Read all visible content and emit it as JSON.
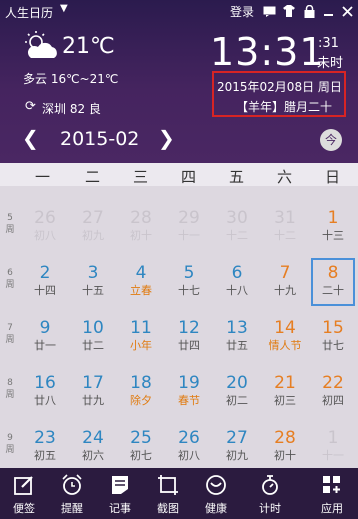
{
  "app_title": "人生日历",
  "login_label": "登录",
  "weather": {
    "temperature": "21℃",
    "condition": "多云 16℃~21℃",
    "city_aqi": "深圳 82 良"
  },
  "clock": {
    "time": "13:31",
    "seconds": ":31",
    "status": "未时"
  },
  "date_info": {
    "gregorian": "2015年02月08日 周日",
    "lunar": "【羊年】腊月二十"
  },
  "nav": {
    "month": "2015-02",
    "today_label": "今"
  },
  "weekdays": [
    "一",
    "二",
    "三",
    "四",
    "五",
    "六",
    "日"
  ],
  "week_labels": [
    "5 周",
    "6 周",
    "7 周",
    "8 周",
    "9 周"
  ],
  "calendar": [
    [
      [
        "26",
        "初八"
      ],
      [
        "27",
        "初九"
      ],
      [
        "28",
        "初十"
      ],
      [
        "29",
        "十一"
      ],
      [
        "30",
        "十二"
      ],
      [
        "31",
        "十二"
      ],
      [
        "1",
        "十三"
      ]
    ],
    [
      [
        "2",
        "十四"
      ],
      [
        "3",
        "十五"
      ],
      [
        "4",
        "立春"
      ],
      [
        "5",
        "十七"
      ],
      [
        "6",
        "十八"
      ],
      [
        "7",
        "十九"
      ],
      [
        "8",
        "二十"
      ]
    ],
    [
      [
        "9",
        "廿一"
      ],
      [
        "10",
        "廿二"
      ],
      [
        "11",
        "小年"
      ],
      [
        "12",
        "廿四"
      ],
      [
        "13",
        "廿五"
      ],
      [
        "14",
        "情人节"
      ],
      [
        "15",
        "廿七"
      ]
    ],
    [
      [
        "16",
        "廿八"
      ],
      [
        "17",
        "廿九"
      ],
      [
        "18",
        "除夕"
      ],
      [
        "19",
        "春节"
      ],
      [
        "20",
        "初二"
      ],
      [
        "21",
        "初三"
      ],
      [
        "22",
        "初四"
      ]
    ],
    [
      [
        "23",
        "初五"
      ],
      [
        "24",
        "初六"
      ],
      [
        "25",
        "初七"
      ],
      [
        "26",
        "初八"
      ],
      [
        "27",
        "初九"
      ],
      [
        "28",
        "初十"
      ],
      [
        "1",
        "十一"
      ]
    ]
  ],
  "colors": {
    "header_bg": "#45245f",
    "date_blue": "#2e86c1",
    "weekend_orange": "#e67e22",
    "festival_orange": "#e07b10",
    "highlight_red": "#d72424"
  },
  "toolbar": [
    "便签",
    "提醒",
    "记事",
    "截图",
    "健康",
    "计时",
    "应用"
  ]
}
